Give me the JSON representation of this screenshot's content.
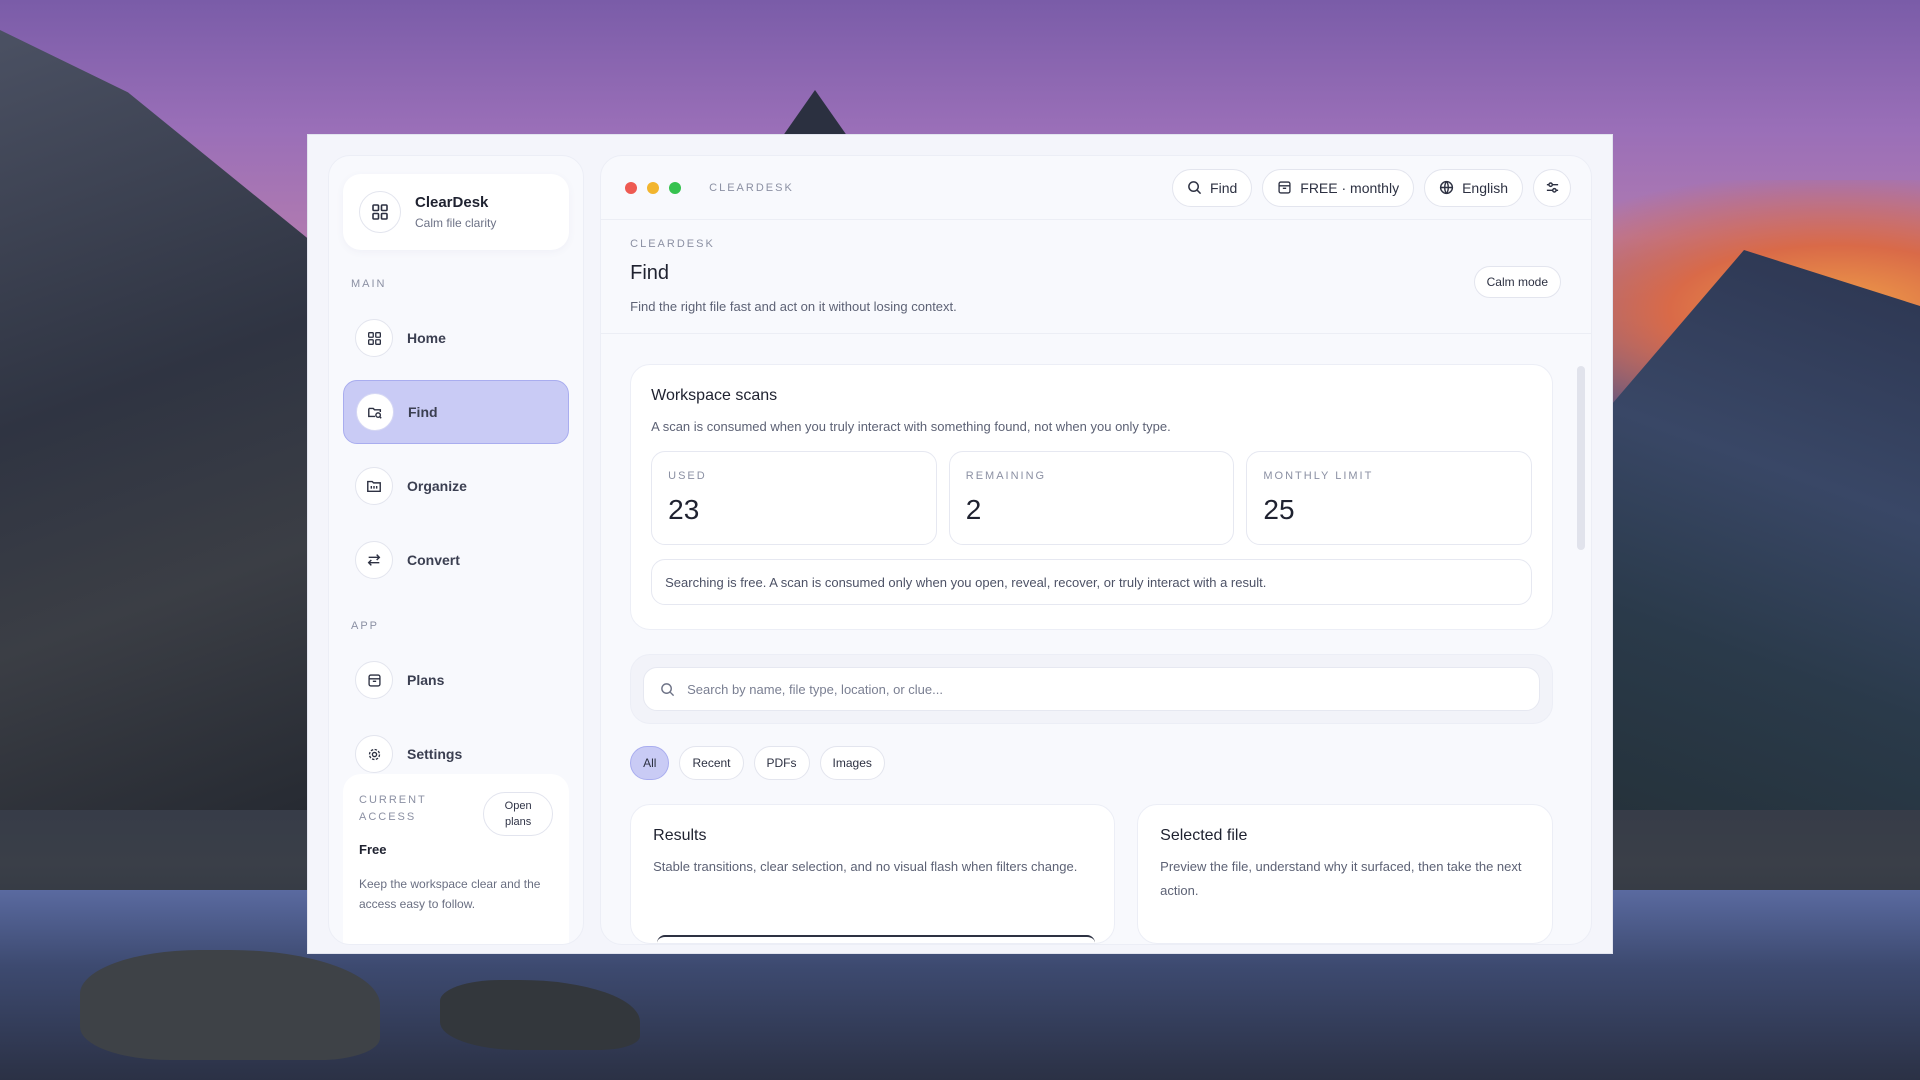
{
  "app": {
    "name": "ClearDesk",
    "tagline": "Calm file clarity",
    "window_title": "CLEARDESK"
  },
  "sidebar": {
    "main_label": "MAIN",
    "app_label": "APP",
    "main_items": [
      {
        "label": "Home",
        "icon": "grid-icon"
      },
      {
        "label": "Find",
        "icon": "folder-search-icon",
        "active": true
      },
      {
        "label": "Organize",
        "icon": "folder-icon"
      },
      {
        "label": "Convert",
        "icon": "swap-icon"
      }
    ],
    "app_items": [
      {
        "label": "Plans",
        "icon": "archive-icon"
      },
      {
        "label": "Settings",
        "icon": "gear-icon"
      }
    ],
    "access": {
      "label": "CURRENT ACCESS",
      "button": "Open plans",
      "plan": "Free",
      "description": "Keep the workspace clear and the access easy to follow."
    }
  },
  "topbar": {
    "find": "Find",
    "plan": "FREE · monthly",
    "language": "English"
  },
  "page": {
    "eyebrow": "CLEARDESK",
    "title": "Find",
    "description": "Find the right file fast and act on it without losing context.",
    "mode_button": "Calm mode"
  },
  "scans": {
    "title": "Workspace scans",
    "description": "A scan is consumed when you truly interact with something found, not when you only type.",
    "stats": [
      {
        "label": "USED",
        "value": "23"
      },
      {
        "label": "REMAINING",
        "value": "2"
      },
      {
        "label": "MONTHLY LIMIT",
        "value": "25"
      }
    ],
    "info": "Searching is free. A scan is consumed only when you open, reveal, recover, or truly interact with a result."
  },
  "search": {
    "placeholder": "Search by name, file type, location, or clue..."
  },
  "filters": [
    "All",
    "Recent",
    "PDFs",
    "Images"
  ],
  "results": {
    "title": "Results",
    "description": "Stable transitions, clear selection, and no visual flash when filters change."
  },
  "selected": {
    "title": "Selected file",
    "description": "Preview the file, understand why it surfaced, then take the next action."
  },
  "colors": {
    "accent": "#c9cbf5",
    "accent_border": "#a9adef",
    "dot_red": "#ee5a52",
    "dot_yellow": "#f2b52e",
    "dot_green": "#36c24f"
  }
}
